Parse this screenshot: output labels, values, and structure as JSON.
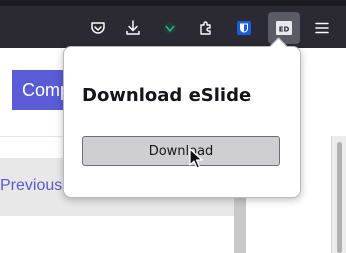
{
  "toolbar": {
    "buttons": [
      {
        "name": "pocket-icon"
      },
      {
        "name": "downloads-icon"
      },
      {
        "name": "extension-icon"
      },
      {
        "name": "extensions-puzzle-icon"
      },
      {
        "name": "bitwarden-icon"
      },
      {
        "name": "eslide-extension-icon",
        "label": "ED",
        "active": true
      },
      {
        "name": "hamburger-menu-icon"
      }
    ]
  },
  "page": {
    "primary_button_label": "Comp",
    "previous_link": "Previous"
  },
  "popup": {
    "title": "Download eSlide",
    "download_button": "Download"
  },
  "colors": {
    "toolbar_bg": "#2b2a33",
    "page_button_bg": "#5b5bd6",
    "link": "#5a5ac8",
    "popup_button_bg": "#cfcfd3"
  }
}
